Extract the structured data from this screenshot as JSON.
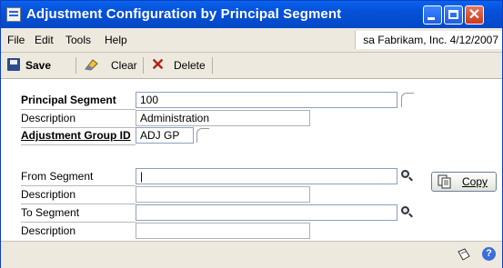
{
  "window": {
    "title": "Adjustment Configuration by Principal Segment"
  },
  "menu": {
    "file": "File",
    "edit": "Edit",
    "tools": "Tools",
    "help": "Help",
    "company_info": "sa  Fabrikam, Inc.  4/12/2007"
  },
  "toolbar": {
    "save": "Save",
    "clear": "Clear",
    "delete": "Delete"
  },
  "form": {
    "principal_segment_label": "Principal Segment",
    "principal_segment_value": "100",
    "description_label": "Description",
    "principal_description_value": "Administration",
    "adjustment_group_label": "Adjustment Group ID",
    "adjustment_group_value": "ADJ GP",
    "from_segment_label": "From Segment",
    "from_segment_value": "|",
    "from_description_label": "Description",
    "from_description_value": "",
    "to_segment_label": "To Segment",
    "to_segment_value": "",
    "to_description_label": "Description",
    "to_description_value": "",
    "copy_button": "Copy"
  },
  "icons": {
    "titlebar": "window-app-icon",
    "save": "save-disk-icon",
    "clear": "eraser-icon",
    "delete": "red-x-icon",
    "lookup": "magnifier-icon",
    "expand": "expand-arrow-icon",
    "copy": "copy-document-icon",
    "note": "note-icon",
    "help": "help-question-icon"
  },
  "colors": {
    "titlebar": "#0551d8",
    "chrome": "#ede9df",
    "delete": "#b02015"
  }
}
